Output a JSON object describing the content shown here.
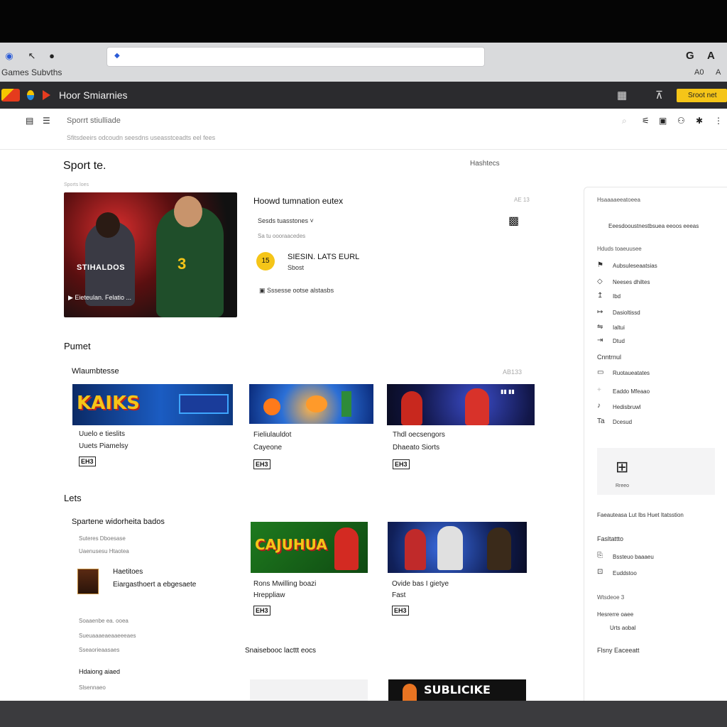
{
  "browser": {
    "tab_title": "Games Subvths",
    "url": "",
    "right_icon_1": "G",
    "right_icon_2": "A",
    "right_text_1": "A0",
    "right_text_2": "A"
  },
  "appbar": {
    "title": "Hoor Smiarnies",
    "cta_label": "Sroot net",
    "icons": [
      "grid-icon",
      "share-icon"
    ]
  },
  "subheader": {
    "crumb": "Sporrt stiulliade",
    "description": "Sfitsdeeirs odcoudn seesdns useasstceadts eel fees"
  },
  "featured": {
    "section_title": "Sport te.",
    "section_sub": "Sports loes",
    "more_link": "Hashtecs",
    "hero_brand": "STIHALDOS",
    "hero_number": "3",
    "hero_play": "Eieteulan. Felatio ...",
    "title": "Hoowd tumnation eutex",
    "date": "AE 13",
    "select_label": "Sesds tuasstones",
    "sub_label": "Sa tu oooraacedes",
    "badge_text": "15",
    "badge_title": "SIESIN. LATS EURL",
    "badge_sub": "Sbost",
    "list_item": "Sssesse ootse alstasbs"
  },
  "rows": [
    {
      "section": "Pumet",
      "title": "Wlaumbtesse",
      "count": "AB133",
      "cards": [
        {
          "thumb_text": "KAIKS",
          "line1": "Uuelo e tieslits",
          "line2": "Uuets Piamelsy",
          "rating": "EH3"
        },
        {
          "thumb_text": "",
          "line1": "Fieliulauldot",
          "line2": "Cayeone",
          "rating": "EH3"
        },
        {
          "thumb_text": "",
          "line1": "Thdl oecsengors",
          "line2": "Dhaeato Siorts",
          "rating": "EH3"
        }
      ]
    },
    {
      "section": "Lets",
      "title": "Spartene widorheita bados",
      "count": "",
      "cards": [
        {
          "thumb_text": "CAJUHUA",
          "line1": "Rons Mwilling boazi",
          "line2": "Hreppliaw",
          "rating": "EH3"
        },
        {
          "thumb_text": "",
          "line1": "Ovide bas I gietye",
          "line2": "Fast",
          "rating": "EH3"
        }
      ]
    }
  ],
  "left_list": {
    "l1": "Suteres Dboesase",
    "l2": "Uaenusesu Htaotea",
    "item_title": "Haetitoes",
    "item_sub": "Eiargasthoert a ebgesaete",
    "l3": "Soaaenbe ea. ooea",
    "l4": "Sueuaaaeaeaaeeeaes",
    "l5": "Hdaiong aiaed",
    "l6": "Sseaorieaasaes",
    "l7": "Slsennaeo",
    "bottom_section": "Snaisebooc lacttt eocs",
    "bottom_thumb_text": "SUBLICIKE"
  },
  "sidebar": {
    "h1": "Hsaaaaeeatoeea",
    "h2": "Eeesdooustnestbsuea eeoos eeeas",
    "h3": "Hduds toaeuusee",
    "items": [
      "Aubsuleseaatsias",
      "Neeses dhiltes",
      "Ibd",
      "Dasioltissd",
      "Ialtui",
      "Dtud"
    ],
    "h4": "Cnntrnul",
    "items2": [
      "Ruotaueatates",
      "Eaddo Mfeaao",
      "Hedisbruwl",
      "Dcesud"
    ],
    "box_label": "Rreeo",
    "h5": "Faeauteasa Lut Ibs Huet Itatsstion",
    "h6": "Fasltattto",
    "items3": [
      "Bssteuo baaaeu",
      "Euddstoo"
    ],
    "h7": "Wtsdeoe 3",
    "items4": [
      "Hesrerre oaee",
      "Urts aobal"
    ],
    "footer": "Flsny Eaceeatt"
  },
  "colors": {
    "accent": "#f5c518",
    "appbar": "#2b2b2e",
    "chrome": "#d9dadc"
  }
}
